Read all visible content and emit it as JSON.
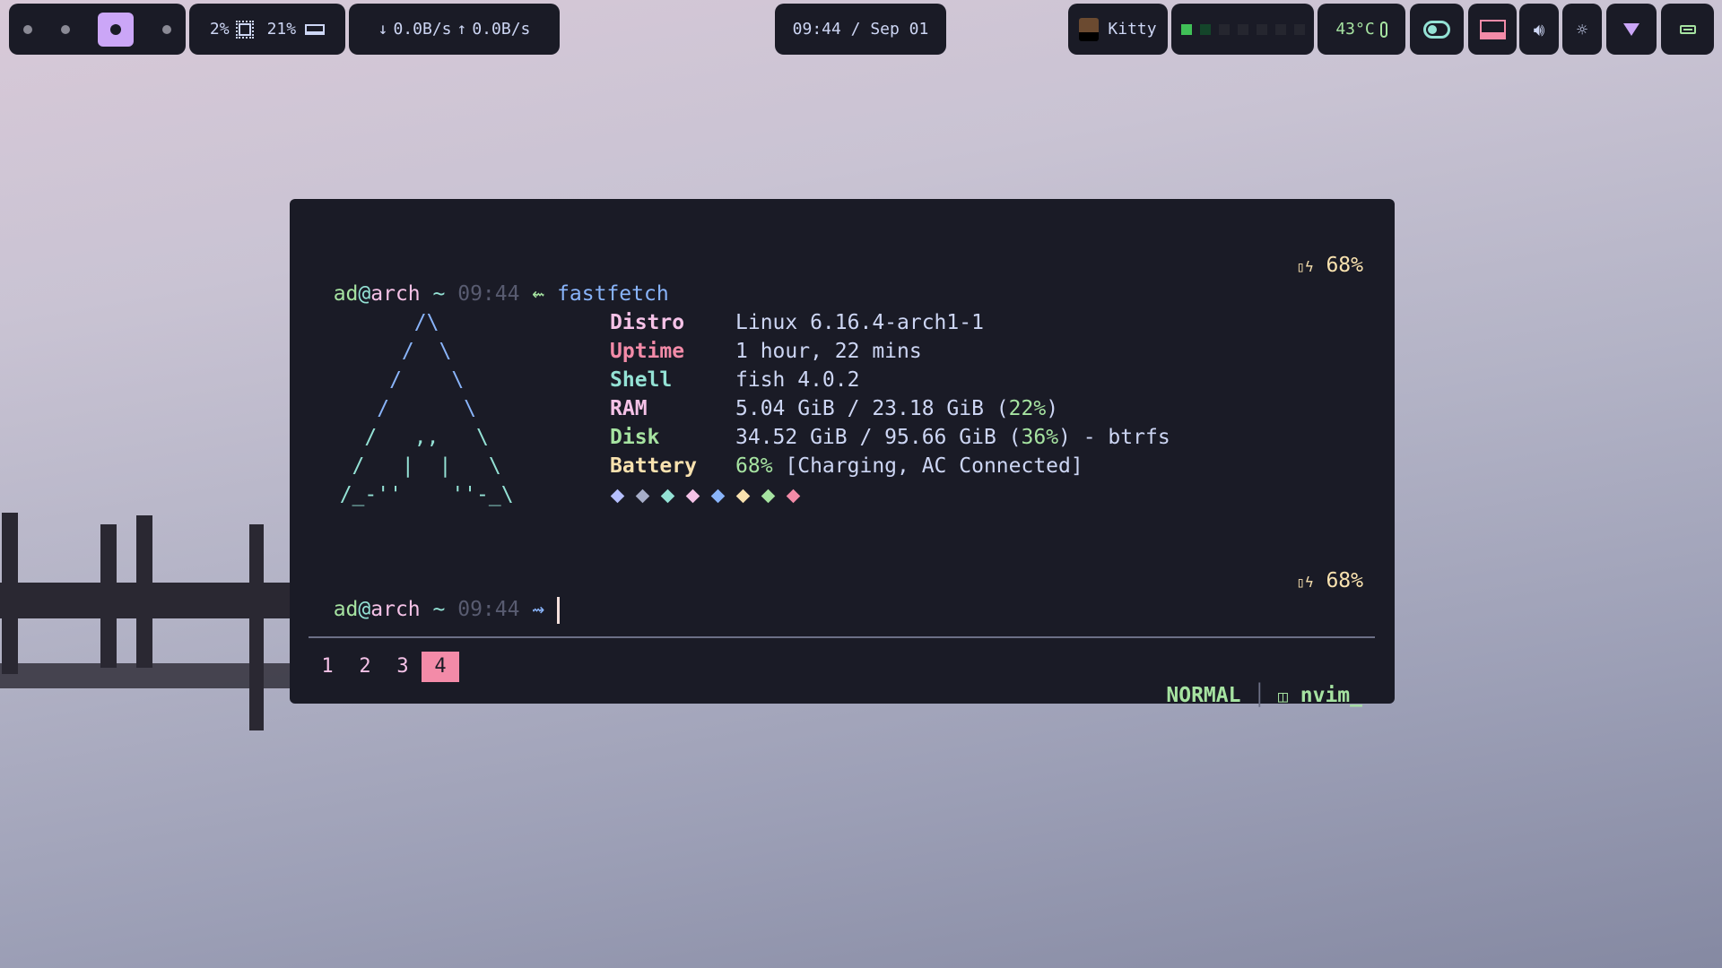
{
  "topbar": {
    "workspaces": {
      "count": 4,
      "active": 3
    },
    "cpu": "2%",
    "ram": "21%",
    "net_down": "0.0B/s",
    "net_up": "0.0B/s",
    "clock": "09:44 / Sep 01",
    "active_app": "Kitty",
    "workspace_indicators": [
      "active",
      "occupied",
      "empty",
      "empty",
      "empty",
      "empty",
      "empty",
      "empty"
    ],
    "temperature": "43°C"
  },
  "terminal": {
    "prompt1": {
      "user": "ad",
      "host": "arch",
      "dir": "~",
      "time": "09:44",
      "command": "fastfetch",
      "battery": "68%"
    },
    "logo": [
      "        /\\",
      "       /  \\",
      "      /    \\",
      "     /      \\",
      "    /   ,,   \\",
      "   /   |  |   \\",
      "  /_-''    ''-_\\"
    ],
    "info": [
      {
        "label": "Distro",
        "value": "Linux 6.16.4-arch1-1",
        "color": "#f5c2e7"
      },
      {
        "label": "Uptime",
        "value": "1 hour, 22 mins",
        "color": "#f38ba8"
      },
      {
        "label": "Shell",
        "value": "fish 4.0.2",
        "color": "#94e2d5"
      },
      {
        "label": "RAM",
        "value_a": "5.04 GiB / 23.18 GiB (",
        "pct": "22%",
        "value_b": ")",
        "color": "#f5c2e7"
      },
      {
        "label": "Disk",
        "value_a": "34.52 GiB / 95.66 GiB (",
        "pct": "36%",
        "value_b": ") - btrfs",
        "color": "#a6e3a1"
      },
      {
        "label": "Battery",
        "pct": "68%",
        "value_b": " [Charging, AC Connected]",
        "color": "#f9e2af"
      }
    ],
    "palette": [
      "#b4befe",
      "#a6adc8",
      "#94e2d5",
      "#f5c2e7",
      "#89b4fa",
      "#f9e2af",
      "#a6e3a1",
      "#f38ba8"
    ],
    "prompt2": {
      "user": "ad",
      "host": "arch",
      "dir": "~",
      "time": "09:44",
      "battery": "68%"
    },
    "tabs": [
      "1",
      "2",
      "3",
      "4"
    ],
    "active_tab": "4",
    "mode": "NORMAL",
    "session": "nvim_"
  }
}
